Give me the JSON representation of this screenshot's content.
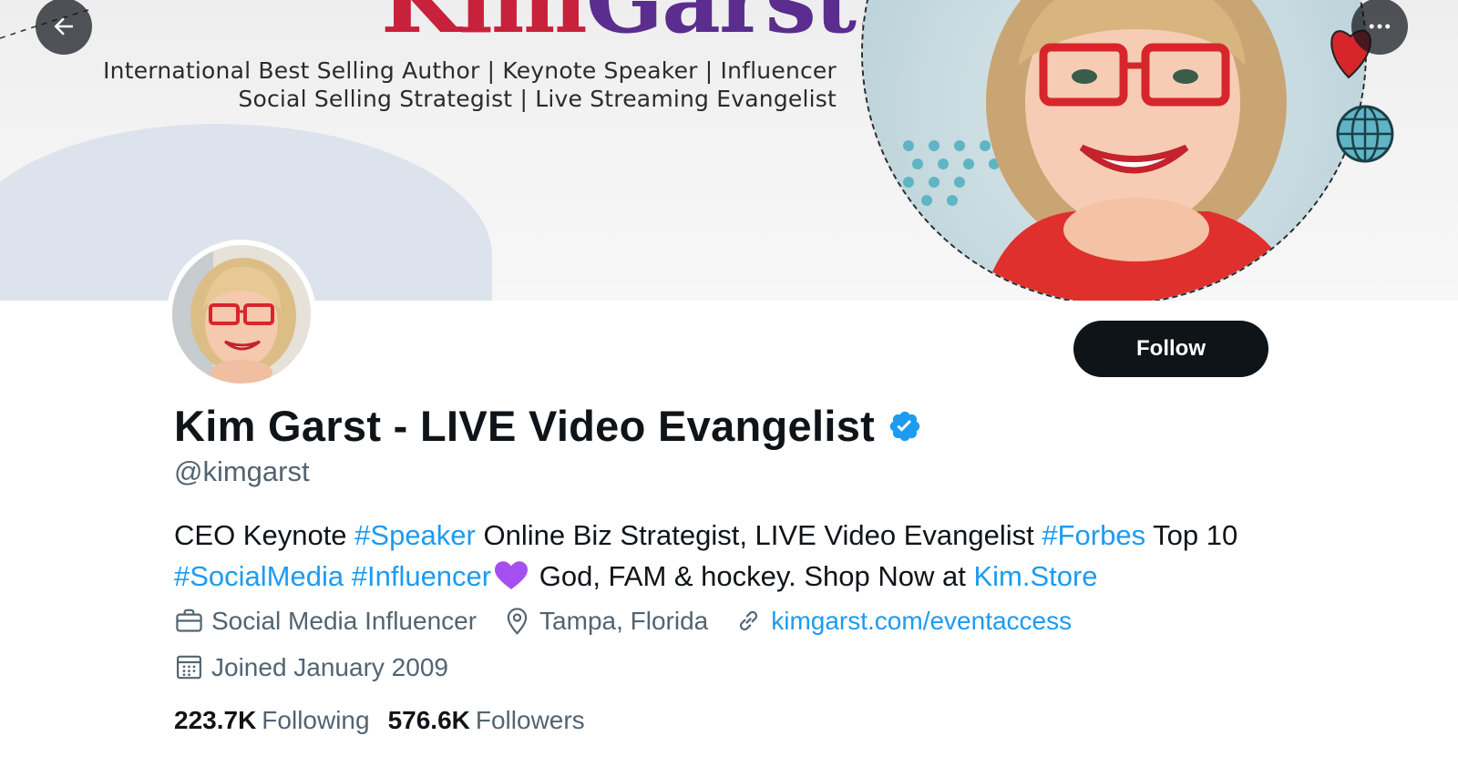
{
  "banner": {
    "logo_kim": "Kim",
    "logo_garst": "Garst",
    "logo_dot": ".",
    "tagline_line1": "International Best Selling Author | Keynote Speaker | Influencer",
    "tagline_line2": "Social Selling Strategist | Live Streaming Evangelist"
  },
  "nav": {
    "back_icon": "arrow-left-icon",
    "more_icon": "more-horizontal-icon"
  },
  "profile": {
    "display_name": "Kim Garst - LIVE Video Evangelist",
    "verified": true,
    "handle": "@kimgarst",
    "follow_label": "Follow",
    "bio": {
      "t1": "CEO Keynote ",
      "h1": "#Speaker",
      "t2": " Online Biz Strategist, LIVE Video Evangelist ",
      "h2": "#Forbes",
      "t3": " Top 10 ",
      "h3": "#SocialMedia",
      "t4": " ",
      "h4": "#Influencer",
      "emoji": "purple-heart-icon",
      "t5": " God, FAM & hockey. Shop Now at ",
      "link": "Kim.Store"
    },
    "category": "Social Media Influencer",
    "location": "Tampa, Florida",
    "website": "kimgarst.com/eventaccess",
    "joined": "Joined January 2009",
    "following_count": "223.7K",
    "following_label": "Following",
    "followers_count": "576.6K",
    "followers_label": "Followers"
  },
  "colors": {
    "accent": "#1d9bf0",
    "text_primary": "#0f1419",
    "text_secondary": "#536471",
    "button_bg": "#0f1419",
    "logo_red": "#c8213b",
    "logo_purple": "#5b2d8e",
    "verified_badge": "#1d9bf0"
  }
}
